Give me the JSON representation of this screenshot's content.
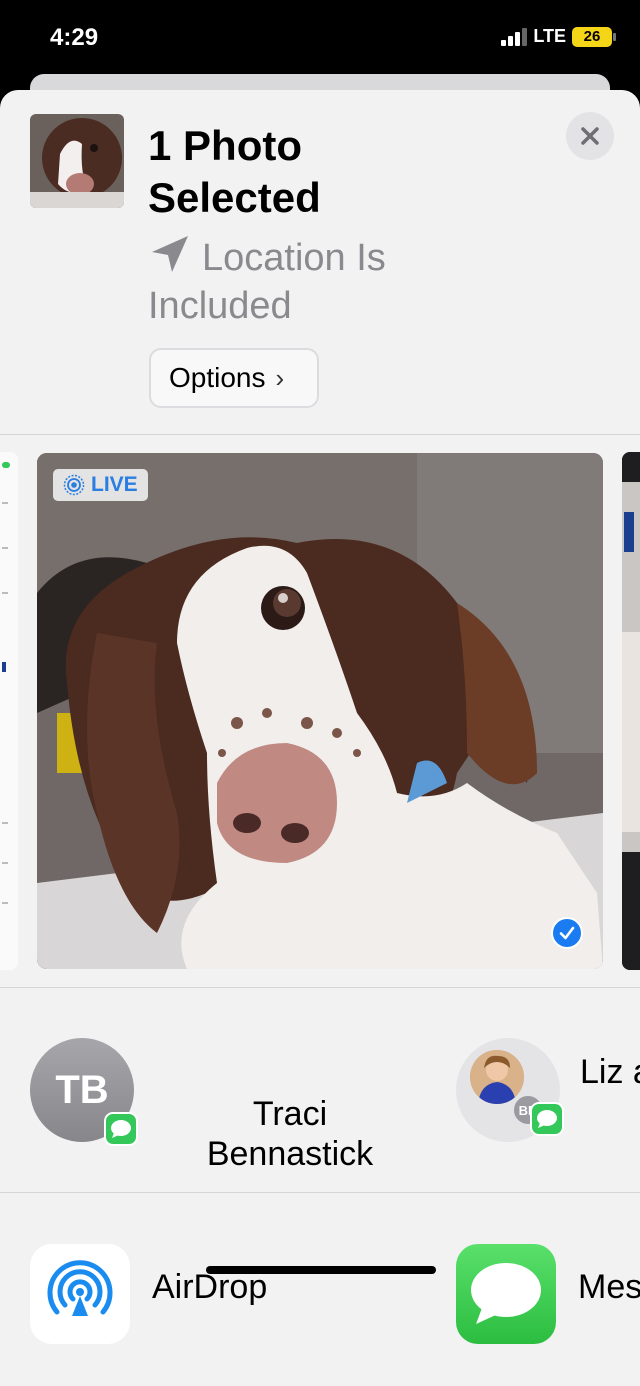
{
  "status_bar": {
    "time": "4:29",
    "network": "LTE",
    "battery": "26"
  },
  "share_sheet": {
    "title": "1 Photo Selected",
    "location_text": "Location Is Included",
    "options_label": "Options",
    "close_icon": "close-icon"
  },
  "photo": {
    "live_label": "LIVE",
    "selected": true
  },
  "people": [
    {
      "initials": "TB",
      "name": "Traci Bennastick"
    },
    {
      "name": "Liz a",
      "badge_initials": "BD"
    }
  ],
  "apps": [
    {
      "name": "AirDrop",
      "icon": "airdrop-icon"
    },
    {
      "name": "Mes",
      "icon": "messages-icon"
    }
  ],
  "colors": {
    "accent": "#1b7cf2",
    "message_green": "#34c759",
    "secondary_text": "#8a8a8e"
  }
}
